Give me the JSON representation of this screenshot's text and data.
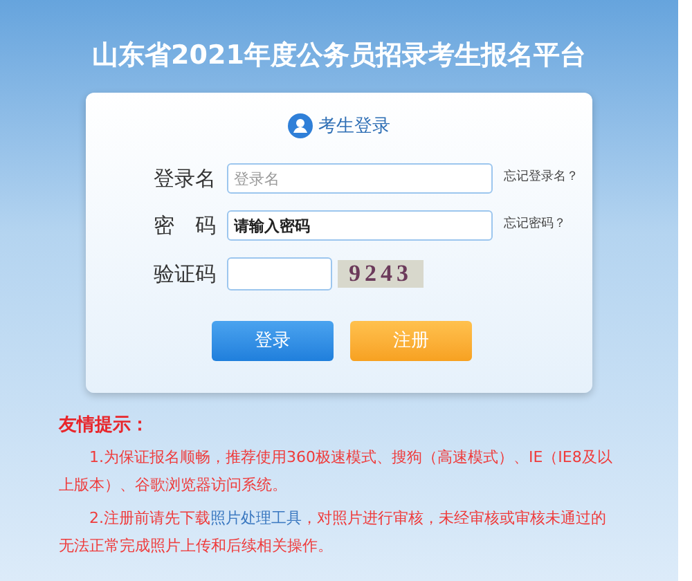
{
  "title": "山东省2021年度公务员招录考生报名平台",
  "login_card": {
    "heading": "考生登录",
    "fields": [
      {
        "kind": "text",
        "label": "登录名",
        "placeholder": "登录名",
        "help_link": "忘记登录名？"
      },
      {
        "kind": "password",
        "label": "密　码",
        "placeholder": "请输入密码",
        "help_link": "忘记密码？"
      },
      {
        "kind": "captcha",
        "label": "验证码",
        "captcha": "9243"
      }
    ],
    "buttons": [
      {
        "kind": "primary",
        "label": "登录"
      },
      {
        "kind": "secondary",
        "label": "注册"
      }
    ]
  },
  "tips": {
    "heading": "友情提示：",
    "items": [
      {
        "text": "1.为保证报名顺畅，推荐使用360极速模式、搜狗（高速模式）、IE（IE8及以上版本）、谷歌浏览器访问系统。"
      },
      {
        "text": "2.注册前请先下载",
        "link": "照片处理工具",
        "text_after": "，对照片进行审核，未经审核或审核未通过的无法正常完成照片上传和后续相关操作。"
      }
    ]
  }
}
